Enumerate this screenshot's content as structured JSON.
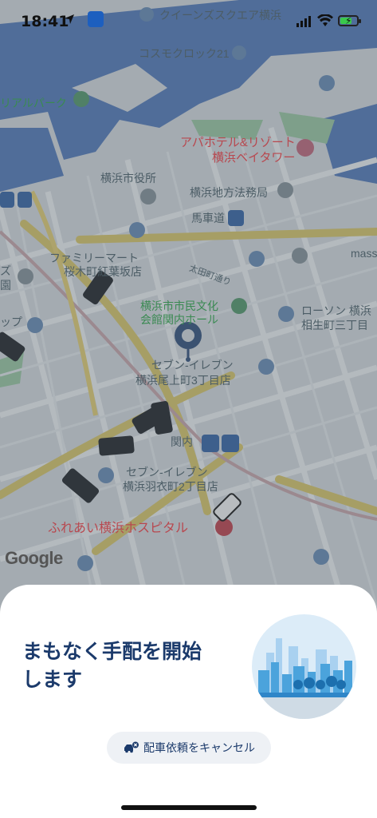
{
  "status_bar": {
    "time": "18:41",
    "icons": [
      "location-arrow-icon",
      "metro-icon",
      "cellular-signal-icon",
      "wifi-icon",
      "battery-charging-icon"
    ]
  },
  "map": {
    "labels": {
      "queens_square": "クイーンズスクエア横浜",
      "cosmo_clock": "コスモクロック21",
      "rial_park": "リアルパーク",
      "apa_hotel": "アパホテル&リゾート",
      "apa_hotel_2": "横浜ベイタワー",
      "city_hall": "横浜市役所",
      "legal_office": "横浜地方法務局",
      "bashamichi": "馬車道",
      "familymart_1": "ファミリーマート",
      "familymart_2": "桜木町紅葉坂店",
      "ota_dori": "太田町通り",
      "kannai_hall_1": "横浜市市民文化",
      "kannai_hall_2": "会館関内ホール",
      "lawson_1": "ローソン 横浜",
      "lawson_2": "相生町三丁目",
      "mass": "mass",
      "seven_onoe_1": "セブン-イレブン",
      "seven_onoe_2": "横浜尾上町3丁目店",
      "kannai": "関内",
      "seven_hagoromo_1": "セブン-イレブン",
      "seven_hagoromo_2": "横浜羽衣町2丁目店",
      "fureai_hospital": "ふれあい横浜ホスピタル",
      "shop_partial": "ップ",
      "gen_partial": "園",
      "z_partial": "ズ"
    },
    "attribution": "Google",
    "colors": {
      "water": "#4d74b8",
      "land": "#d6dadf",
      "road": "#f0f1f3",
      "major_road": "#d9c76f",
      "park": "#9ec9a6",
      "dim": "rgba(60,70,80,0.32)"
    }
  },
  "sheet": {
    "headline": "まもなく手配を開始\nします",
    "cancel_button": "配車依頼をキャンセル",
    "cancel_icon": "car-cancel-icon",
    "illustration": "city-skyline-illustration"
  }
}
